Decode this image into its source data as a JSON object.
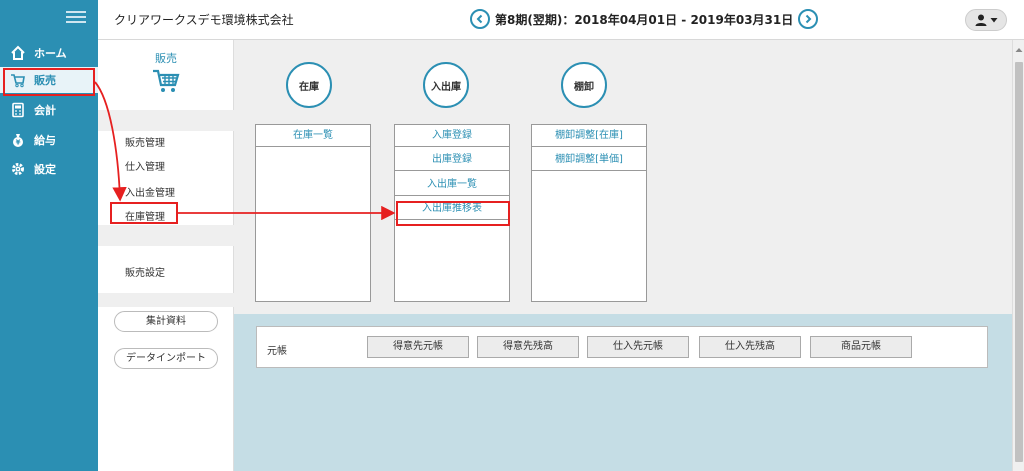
{
  "nav": {
    "items": [
      {
        "label": "ホーム",
        "icon": "home-icon"
      },
      {
        "label": "販売",
        "icon": "cart-icon"
      },
      {
        "label": "会計",
        "icon": "calculator-icon"
      },
      {
        "label": "給与",
        "icon": "money-bag-icon"
      },
      {
        "label": "設定",
        "icon": "gear-icon"
      }
    ]
  },
  "header": {
    "company": "クリアワークスデモ環境株式会社",
    "period": "第8期(翌期)：2018年04月01日 - 2019年03月31日"
  },
  "submenu": {
    "title": "販売",
    "links": [
      "販売管理",
      "仕入管理",
      "入出金管理",
      "在庫管理"
    ],
    "settings": "販売設定",
    "buttons": [
      "集計資料",
      "データインポート"
    ]
  },
  "groups": [
    {
      "title": "在庫",
      "buttons": [
        "在庫一覧"
      ]
    },
    {
      "title": "入出庫",
      "buttons": [
        "入庫登録",
        "出庫登録",
        "入出庫一覧",
        "入出庫推移表"
      ]
    },
    {
      "title": "棚卸",
      "buttons": [
        "棚卸調整[在庫]",
        "棚卸調整[単価]"
      ]
    }
  ],
  "ledger": {
    "label": "元帳",
    "buttons": [
      "得意先元帳",
      "得意先残高",
      "仕入先元帳",
      "仕入先残高",
      "商品元帳"
    ]
  },
  "colors": {
    "accent": "#2b8fb3",
    "annotation": "#e62020"
  }
}
